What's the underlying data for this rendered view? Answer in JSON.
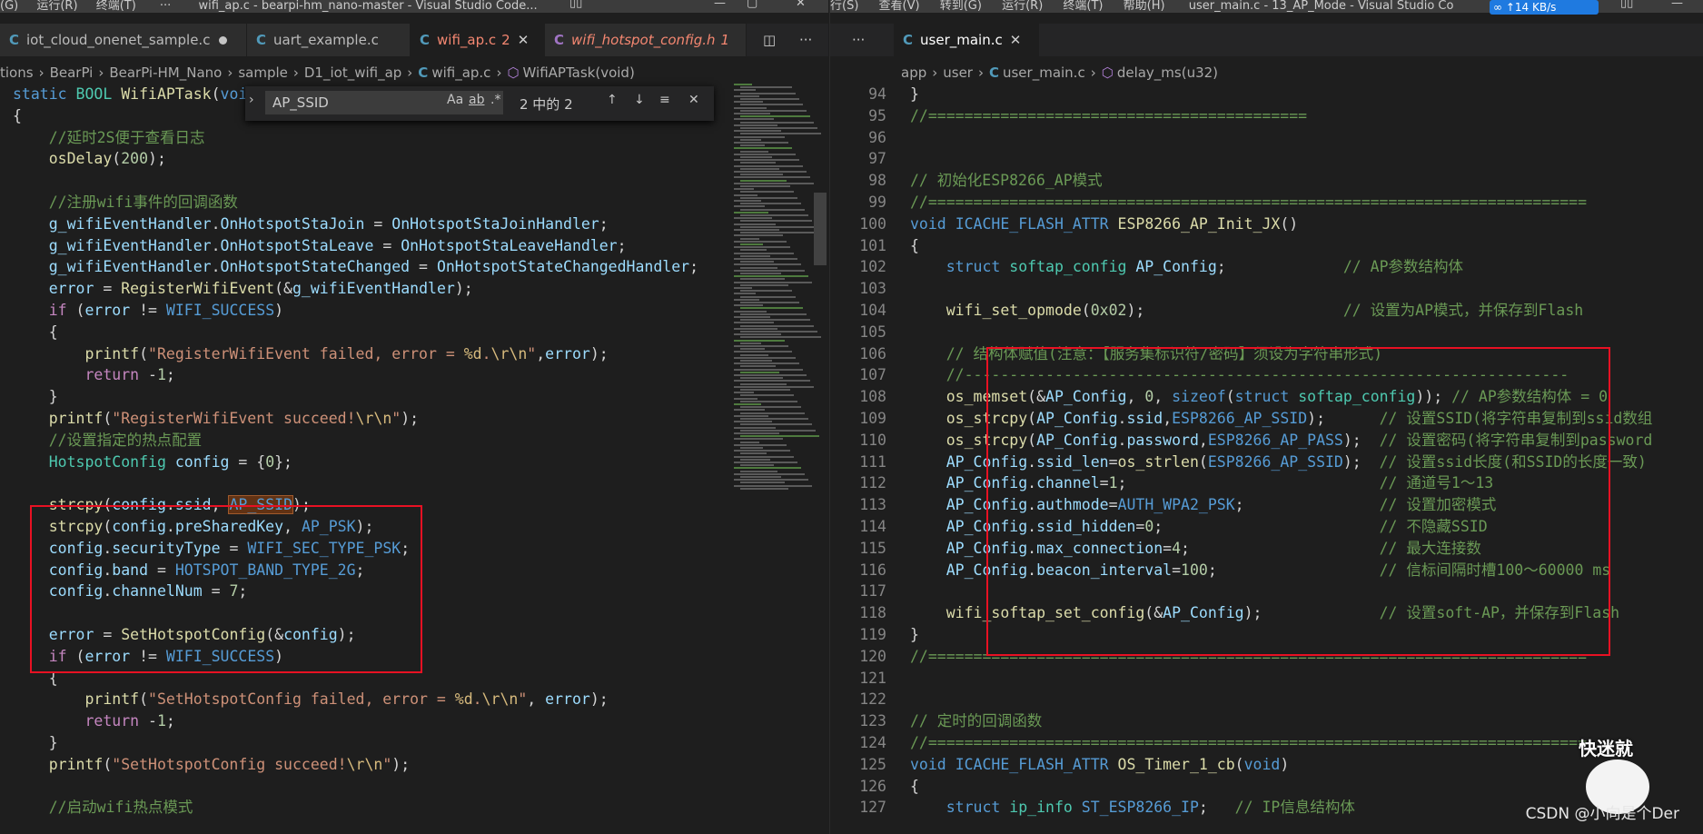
{
  "left_window": {
    "title_bar": {
      "menus": [
        "(G)",
        "运行(R)",
        "终端(T)",
        "···"
      ],
      "title": "wifi_ap.c - bearpi-hm_nano-master - Visual Studio Code..."
    },
    "tabs": [
      {
        "label": "iot_cloud_onenet_sample.c",
        "state": "modified"
      },
      {
        "label": "uart_example.c",
        "state": ""
      },
      {
        "label": "wifi_ap.c",
        "badge": "2",
        "state": "active"
      },
      {
        "label": "wifi_hotspot_config.h",
        "badge": "1",
        "state": "error"
      }
    ],
    "breadcrumb": [
      "tions",
      "BearPi",
      "BearPi-HM_Nano",
      "sample",
      "D1_iot_wifi_ap",
      "wifi_ap.c",
      "WifiAPTask(void)"
    ],
    "find_widget": {
      "query": "AP_SSID",
      "opt_case": "Aa",
      "opt_word": "ab",
      "opt_regex": ".*",
      "result": "2 中的 2"
    },
    "code_lines": [
      "static BOOL WifiAPTask(void)",
      "{",
      "    //延时2S便于查看日志",
      "    osDelay(200);",
      "",
      "    //注册wifi事件的回调函数",
      "    g_wifiEventHandler.OnHotspotStaJoin = OnHotspotStaJoinHandler;",
      "    g_wifiEventHandler.OnHotspotStaLeave = OnHotspotStaLeaveHandler;",
      "    g_wifiEventHandler.OnHotspotStateChanged = OnHotspotStateChangedHandler;",
      "    error = RegisterWifiEvent(&g_wifiEventHandler);",
      "    if (error != WIFI_SUCCESS)",
      "    {",
      "        printf(\"RegisterWifiEvent failed, error = %d.\\r\\n\",error);",
      "        return -1;",
      "    }",
      "    printf(\"RegisterWifiEvent succeed!\\r\\n\");",
      "    //设置指定的热点配置",
      "    HotspotConfig config = {0};",
      "",
      "    strcpy(config.ssid, AP_SSID);",
      "    strcpy(config.preSharedKey, AP_PSK);",
      "    config.securityType = WIFI_SEC_TYPE_PSK;",
      "    config.band = HOTSPOT_BAND_TYPE_2G;",
      "    config.channelNum = 7;",
      "",
      "    error = SetHotspotConfig(&config);",
      "    if (error != WIFI_SUCCESS)",
      "    {",
      "        printf(\"SetHotspotConfig failed, error = %d.\\r\\n\", error);",
      "        return -1;",
      "    }",
      "    printf(\"SetHotspotConfig succeed!\\r\\n\");",
      "",
      "    //启动wifi热点模式"
    ]
  },
  "right_window": {
    "title_bar": {
      "menus": [
        "行(S)",
        "查看(V)",
        "转到(G)",
        "运行(R)",
        "终端(T)",
        "帮助(H)"
      ],
      "title": "user_main.c - 13_AP_Mode - Visual Studio Co",
      "net_speed": "↑14 KB/s"
    },
    "tabs": [
      {
        "label": "user_main.c",
        "state": "active"
      }
    ],
    "tab_overflow": "···",
    "breadcrumb": [
      "app",
      "user",
      "user_main.c",
      "delay_ms(u32)"
    ],
    "line_numbers": [
      "94",
      "95",
      "96",
      "97",
      "98",
      "99",
      "100",
      "101",
      "102",
      "103",
      "104",
      "105",
      "106",
      "107",
      "108",
      "109",
      "110",
      "111",
      "112",
      "113",
      "114",
      "115",
      "116",
      "117",
      "118",
      "119",
      "120",
      "121",
      "122",
      "123",
      "124",
      "125",
      "126",
      "127"
    ],
    "code_lines": [
      "}",
      "//==========================================",
      "",
      "",
      "// 初始化ESP8266_AP模式",
      "//=========================================================================",
      "void ICACHE_FLASH_ATTR ESP8266_AP_Init_JX()",
      "{",
      "    struct softap_config AP_Config;             // AP参数结构体",
      "",
      "    wifi_set_opmode(0x02);                      // 设置为AP模式，并保存到Flash",
      "",
      "    // 结构体赋值(注意：【服务集标识符/密码】须设为字符串形式)",
      "    //-------------------------------------------------------------------",
      "    os_memset(&AP_Config, 0, sizeof(struct softap_config)); // AP参数结构体 = 0",
      "    os_strcpy(AP_Config.ssid,ESP8266_AP_SSID);      // 设置SSID(将字符串复制到ssid数组",
      "    os_strcpy(AP_Config.password,ESP8266_AP_PASS);  // 设置密码(将字符串复制到password",
      "    AP_Config.ssid_len=os_strlen(ESP8266_AP_SSID);  // 设置ssid长度(和SSID的长度一致)",
      "    AP_Config.channel=1;                            // 通道号1～13",
      "    AP_Config.authmode=AUTH_WPA2_PSK;               // 设置加密模式",
      "    AP_Config.ssid_hidden=0;                        // 不隐藏SSID",
      "    AP_Config.max_connection=4;                     // 最大连接数",
      "    AP_Config.beacon_interval=100;                  // 信标间隔时槽100～60000 ms",
      "",
      "    wifi_softap_set_config(&AP_Config);             // 设置soft-AP，并保存到Flash",
      "}",
      "//=========================================================================",
      "",
      "",
      "// 定时的回调函数",
      "//=========================================================================",
      "void ICACHE_FLASH_ATTR OS_Timer_1_cb(void)",
      "{",
      "    struct ip_info ST_ESP8266_IP;   // IP信息结构体"
    ],
    "watermark": "CSDN @小向是个Der",
    "sticker": "快迷就"
  }
}
